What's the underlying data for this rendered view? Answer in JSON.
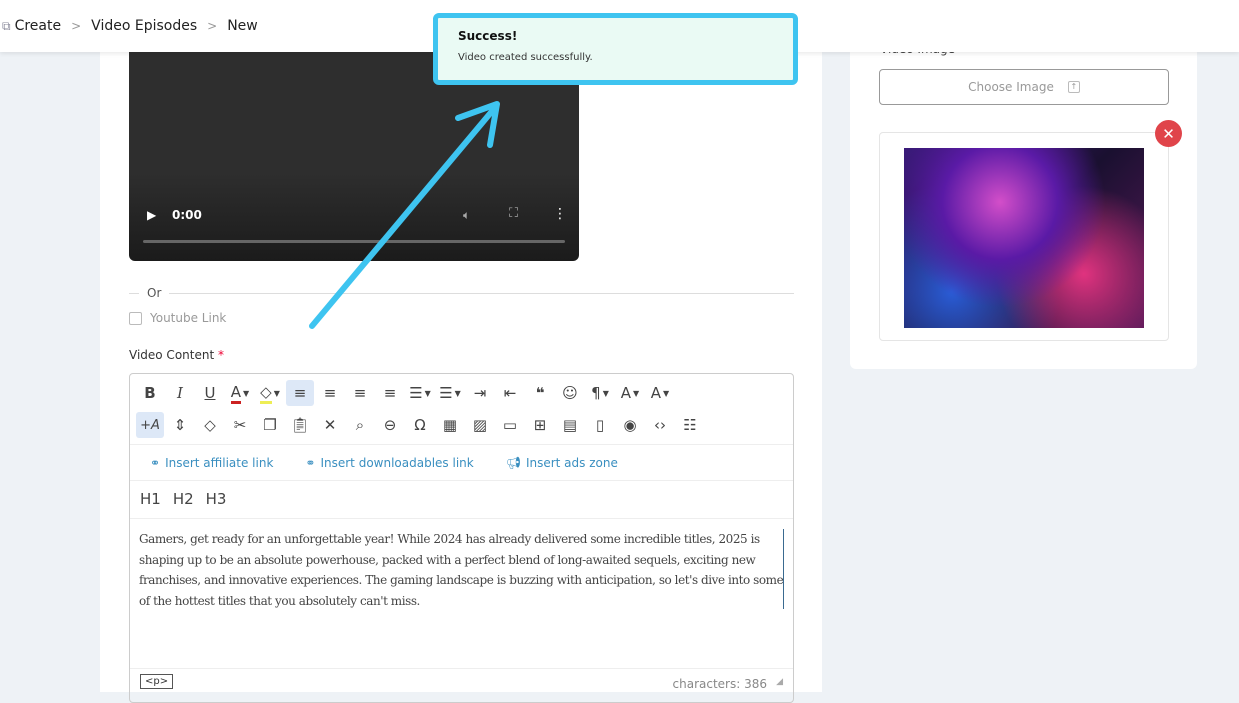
{
  "breadcrumb": {
    "items": [
      "Create",
      "Video Episodes",
      "New"
    ]
  },
  "toast": {
    "title": "Success!",
    "message": "Video created successfully."
  },
  "video": {
    "time": "0:00"
  },
  "form": {
    "or_label": "Or",
    "youtube_label": "Youtube Link",
    "video_content_label": "Video Content",
    "required_mark": "*"
  },
  "editor": {
    "links": {
      "affiliate": "Insert affiliate link",
      "downloadables": "Insert downloadables link",
      "ads": "Insert ads zone"
    },
    "headings": [
      "H1",
      "H2",
      "H3"
    ],
    "content": "Gamers, get ready for an unforgettable year! While 2024 has already delivered some incredible titles, 2025 is shaping up to be an absolute powerhouse, packed with a perfect blend of long-awaited sequels, exciting new franchises, and innovative experiences. The gaming landscape is buzzing with anticipation, so let's dive into some of the hottest titles that you absolutely can't miss.",
    "path_tag": "<p>",
    "char_count": "characters: 386"
  },
  "sidebar": {
    "video_image_label": "Video Image",
    "choose_image": "Choose Image"
  },
  "colors": {
    "accent": "#3ec4f0",
    "toast_bg": "#eafaf4",
    "remove": "#e0444a",
    "link": "#3a8fc0"
  }
}
